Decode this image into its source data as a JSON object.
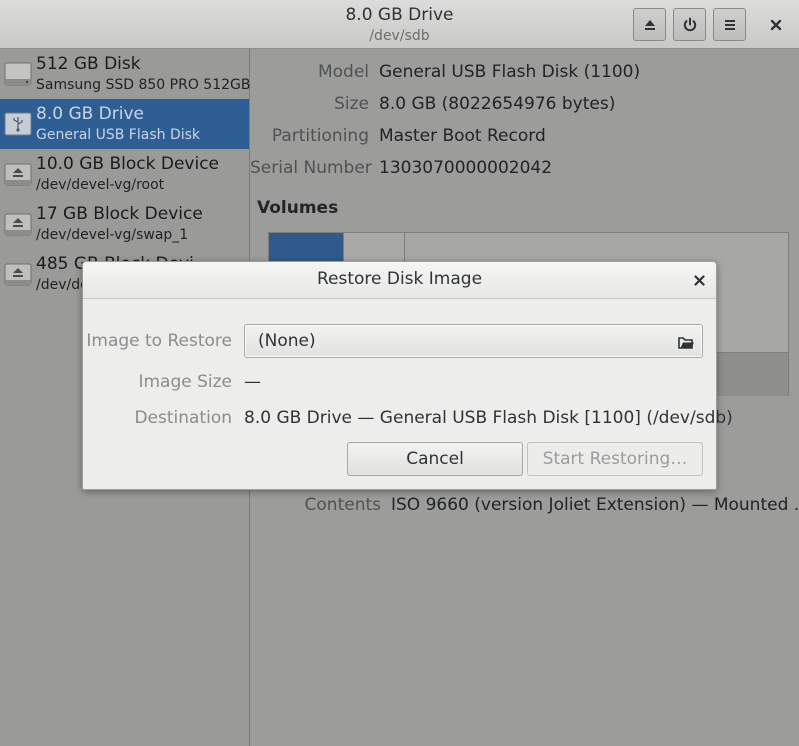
{
  "window": {
    "title": "8.0 GB Drive",
    "subtitle": "/dev/sdb",
    "buttons": {
      "eject_icon": "eject-icon",
      "power_icon": "power-icon",
      "menu_icon": "menu-icon",
      "close_icon": "close-icon"
    }
  },
  "sidebar": {
    "items": [
      {
        "name": "512 GB Disk",
        "sub": "Samsung SSD 850 PRO 512GB",
        "icon": "hard-disk-icon",
        "selected": false
      },
      {
        "name": "8.0 GB Drive",
        "sub": "General USB Flash Disk",
        "icon": "usb-drive-icon",
        "selected": true
      },
      {
        "name": "10.0 GB Block Device",
        "sub": "/dev/devel-vg/root",
        "icon": "block-device-icon",
        "selected": false
      },
      {
        "name": "17 GB Block Device",
        "sub": "/dev/devel-vg/swap_1",
        "icon": "block-device-icon",
        "selected": false
      },
      {
        "name": "485 GB Block Devi",
        "sub": "/dev/de",
        "icon": "block-device-icon",
        "selected": false
      }
    ]
  },
  "main": {
    "properties": [
      {
        "label": "Model",
        "value": "General USB Flash Disk (1100)"
      },
      {
        "label": "Size",
        "value": "8.0 GB (8022654976 bytes)"
      },
      {
        "label": "Partitioning",
        "value": "Master Boot Record"
      },
      {
        "label": "Serial Number",
        "value": "1303070000002042"
      }
    ],
    "volumes_heading": "Volumes",
    "contents_label": "Contents",
    "contents_value": "ISO 9660 (version Joliet Extension) — Mounted ..."
  },
  "dialog": {
    "title": "Restore Disk Image",
    "image_label": "Image to Restore",
    "image_value": "(None)",
    "size_label": "Image Size",
    "size_value": "—",
    "destination_label": "Destination",
    "destination_value": "8.0 GB Drive — General USB Flash Disk [1100] (/dev/sdb)",
    "cancel_label": "Cancel",
    "start_label": "Start Restoring…"
  },
  "colors": {
    "selection": "#2f5e94",
    "volume_fill": "#305a8a",
    "dialog_bg": "#ededeb"
  }
}
